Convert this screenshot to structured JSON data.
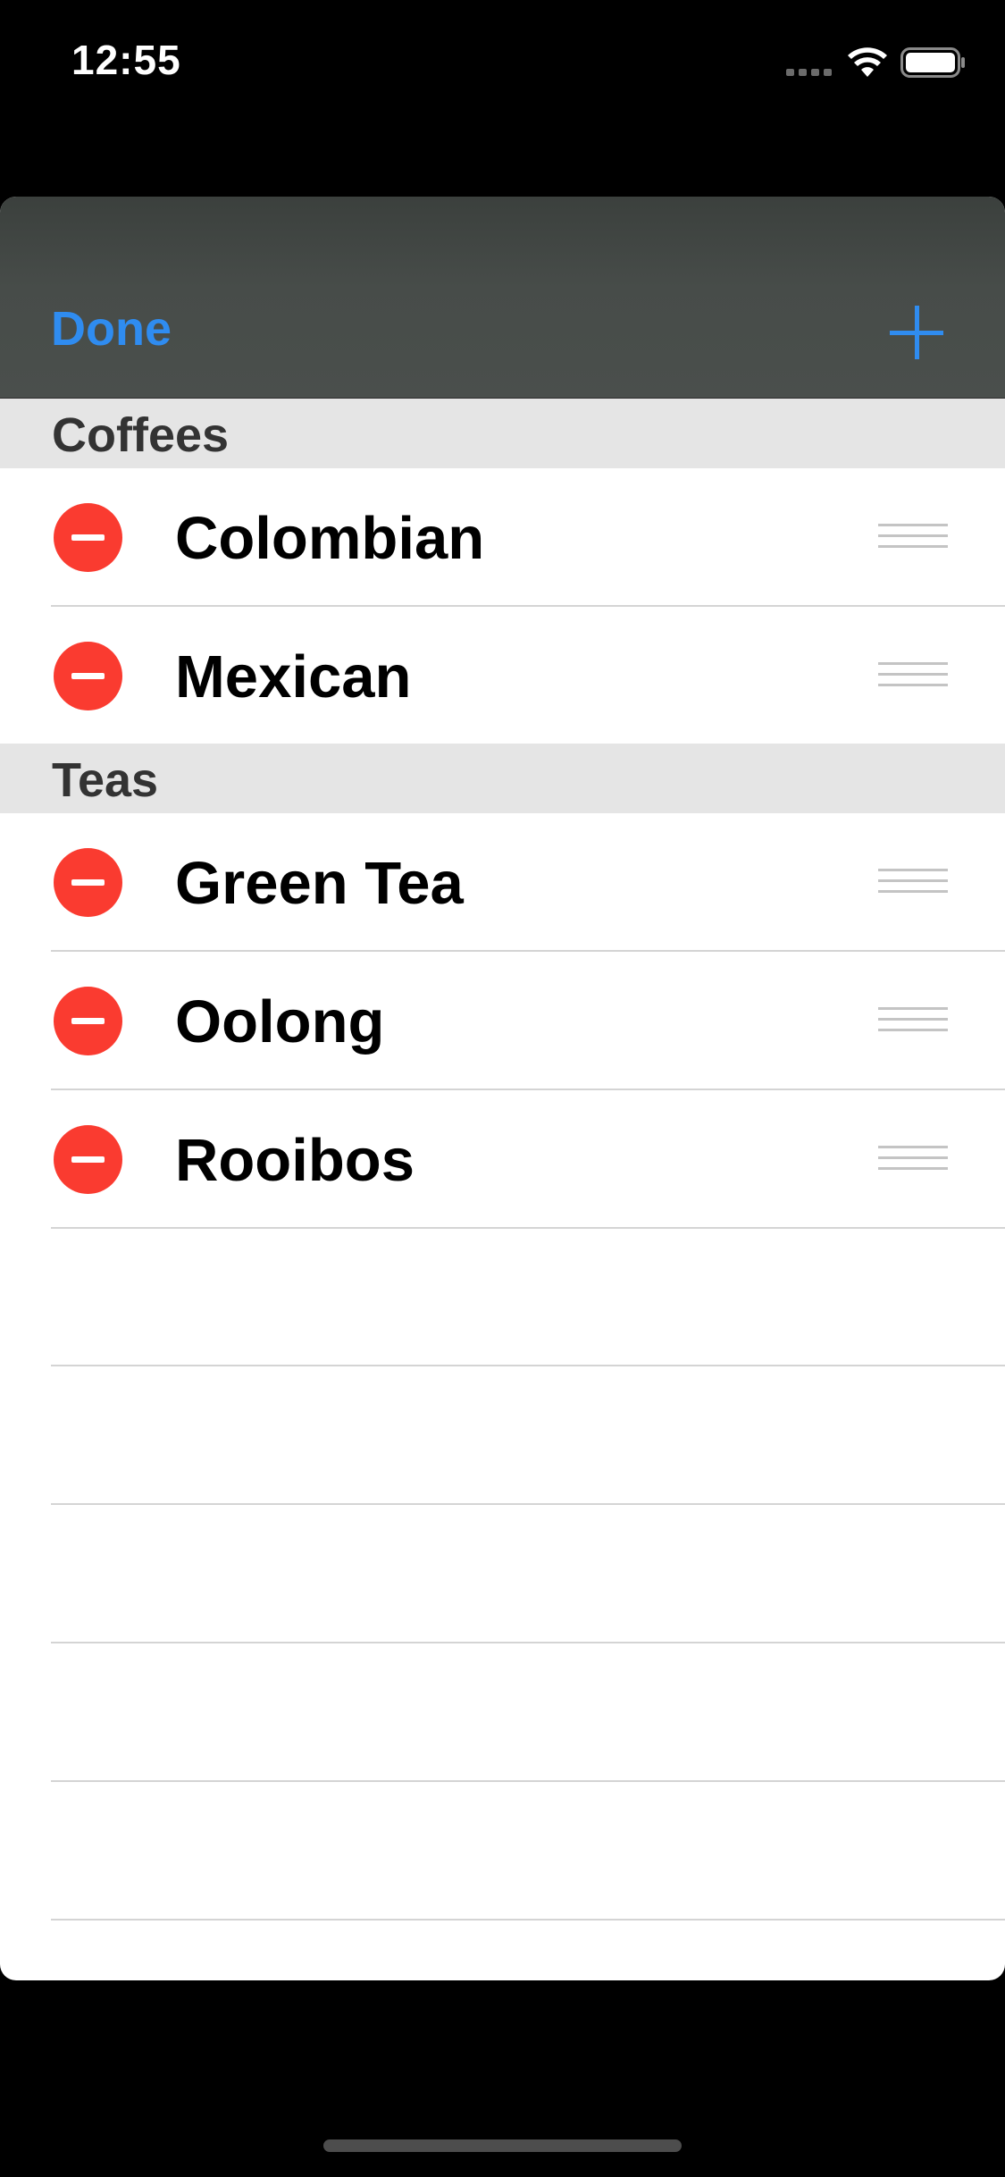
{
  "status_bar": {
    "time": "12:55",
    "icons": [
      "cellular-signal-icon",
      "wifi-icon",
      "battery-icon"
    ],
    "text_color": "#ffffff"
  },
  "nav_bar": {
    "done_label": "Done",
    "add_icon": "plus-icon",
    "accent_color": "#2f8cf0"
  },
  "sections": [
    {
      "title": "Coffees",
      "items": [
        {
          "label": "Colombian"
        },
        {
          "label": "Mexican"
        }
      ]
    },
    {
      "title": "Teas",
      "items": [
        {
          "label": "Green Tea"
        },
        {
          "label": "Oolong"
        },
        {
          "label": "Rooibos"
        }
      ]
    }
  ],
  "colors": {
    "delete": "#fa3b30",
    "section_background": "#e5e5e5",
    "separator": "#d4d4d4"
  }
}
